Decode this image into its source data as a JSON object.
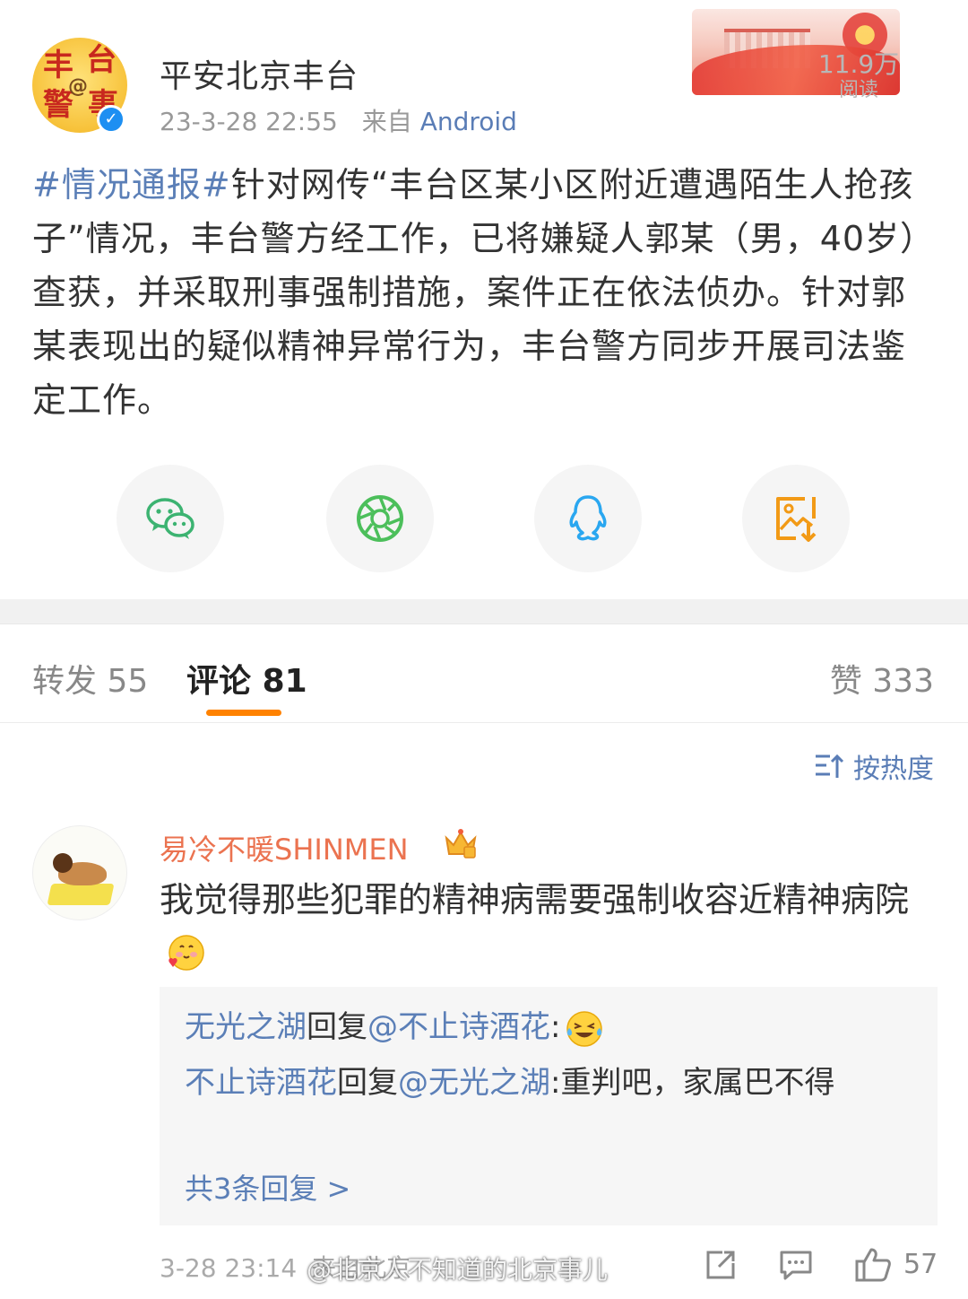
{
  "post": {
    "author": "平安北京丰台",
    "avatar_text": [
      "丰",
      "台",
      "警",
      "事",
      "@"
    ],
    "time": "23-3-28 22:55",
    "source_prefix": "来自",
    "source": "Android",
    "reads_num": "11.9万",
    "reads_label": "阅读",
    "topic": "#情况通报#",
    "text": "针对网传“丰台区某小区附近遭遇陌生人抢孩子”情况，丰台警方经工作，已将嫌疑人郭某（男，40岁）查获，并采取刑事强制措施，案件正在依法侦办。针对郭某表现出的疑似精神异常行为，丰台警方同步开展司法鉴定工作。",
    "share_icons": [
      "wechat-icon",
      "moments-icon",
      "qq-icon",
      "save-image-icon"
    ]
  },
  "tabs": {
    "repost_label": "转发",
    "repost_count": "55",
    "comments_label": "评论",
    "comments_count": "81",
    "likes_label": "赞",
    "likes_count": "333"
  },
  "sort": {
    "label": "按热度"
  },
  "comment": {
    "username": "易冷不暖SHINMEN",
    "text": "我觉得那些犯罪的精神病需要强制收容近精神病院",
    "replies": [
      {
        "name": "无光之湖",
        "verb": "回复",
        "target": "@不止诗酒花",
        "colon": ":",
        "content": ""
      },
      {
        "name": "不止诗酒花",
        "verb": "回复",
        "target": "@无光之湖",
        "colon": ":",
        "content": "重判吧，家属巴不得"
      }
    ],
    "more_replies": "共3条回复 >",
    "time": "3-28 23:14",
    "source": "来自北京",
    "like_count": "57"
  },
  "watermark": "@北京人不知道的北京事儿",
  "colors": {
    "link": "#5b7fb7",
    "username_orange": "#eb7350",
    "tab_underline": "#ff8200",
    "verified_blue": "#1d8ff2"
  }
}
